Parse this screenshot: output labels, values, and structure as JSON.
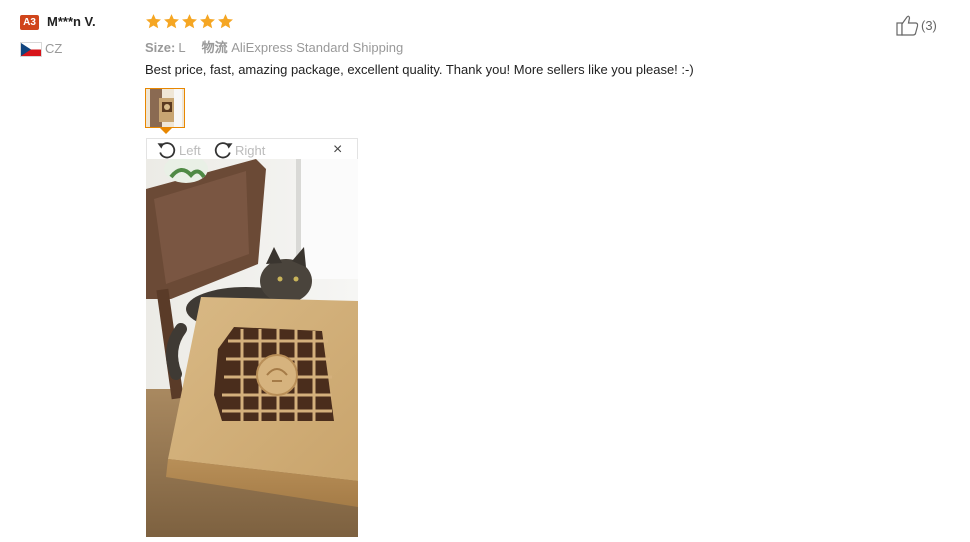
{
  "user": {
    "level_badge": "A3",
    "name": "M***n V.",
    "country_code": "CZ",
    "flag_icon": "czech-flag-icon"
  },
  "review": {
    "rating": 5,
    "rating_max": 5,
    "size_label": "Size:",
    "size_value": "L",
    "shipping_label": "物流",
    "shipping_value": "AliExpress Standard Shipping",
    "text": "Best price, fast, amazing package, excellent quality. Thank you! More sellers like you please! :-)"
  },
  "viewer": {
    "rotate_left_label": "Left",
    "rotate_right_label": "Right",
    "close_label": "×"
  },
  "like": {
    "count": "(3)"
  },
  "colors": {
    "star": "#f5a623",
    "badge": "#d0451b",
    "thumb_border": "#e88700"
  }
}
